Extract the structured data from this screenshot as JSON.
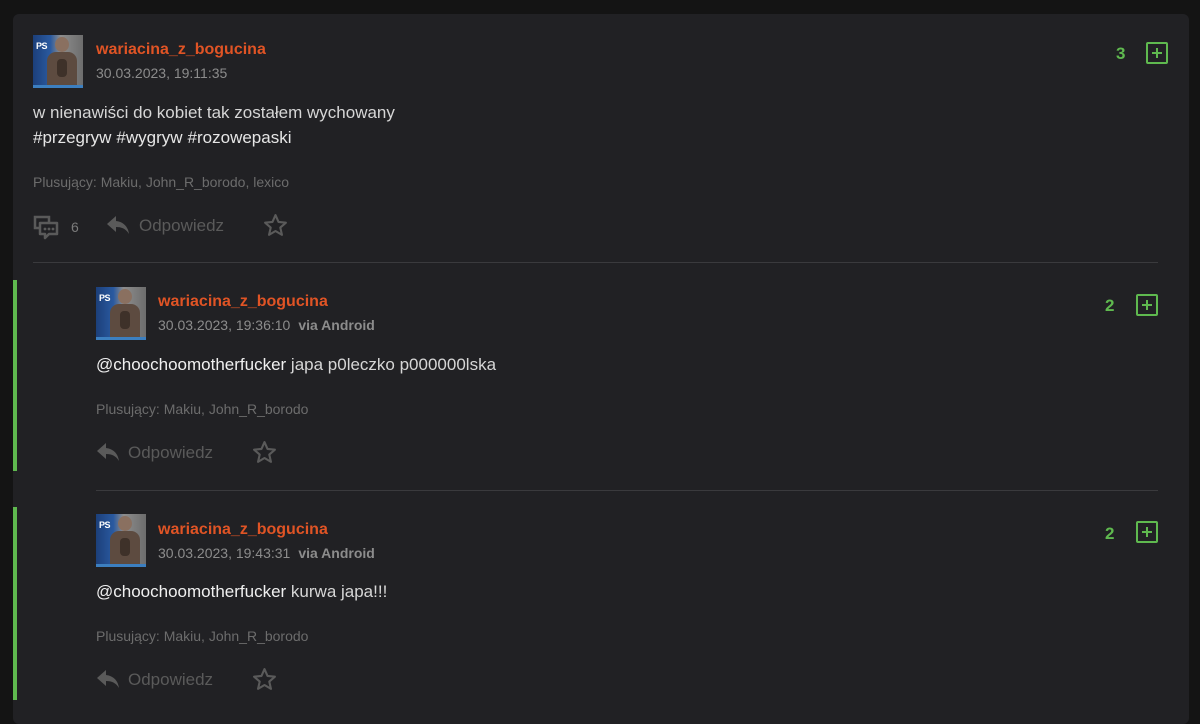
{
  "colors": {
    "accent_green": "#5fb94f",
    "username_orange": "#e05425",
    "avatar_underline": "#3c7fc0"
  },
  "post": {
    "username": "wariacina_z_bogucina",
    "timestamp": "30.03.2023, 19:11:35",
    "votes": "3",
    "body": "w nienawiści do kobiet tak zostałem wychowany",
    "tags": [
      "#przegryw",
      "#wygryw",
      "#rozowepaski"
    ],
    "plusers": "Plusujący: Makiu, John_R_borodo, lexico",
    "comment_count": "6",
    "reply_label": "Odpowiedz",
    "avatar_logo": "PS",
    "icons": {
      "comments": "comments-icon",
      "reply": "reply-icon",
      "favorite": "star-icon",
      "plus": "plus-box-icon"
    }
  },
  "replies": [
    {
      "username": "wariacina_z_bogucina",
      "timestamp": "30.03.2023, 19:36:10",
      "via": "via Android",
      "votes": "2",
      "mention": "@choochoomotherfucker",
      "body": "japa p0leczko p000000lska",
      "plusers": "Plusujący: Makiu, John_R_borodo",
      "reply_label": "Odpowiedz"
    },
    {
      "username": "wariacina_z_bogucina",
      "timestamp": "30.03.2023, 19:43:31",
      "via": "via Android",
      "votes": "2",
      "mention": "@choochoomotherfucker",
      "body": "kurwa japa!!!",
      "plusers": "Plusujący: Makiu, John_R_borodo",
      "reply_label": "Odpowiedz"
    }
  ]
}
